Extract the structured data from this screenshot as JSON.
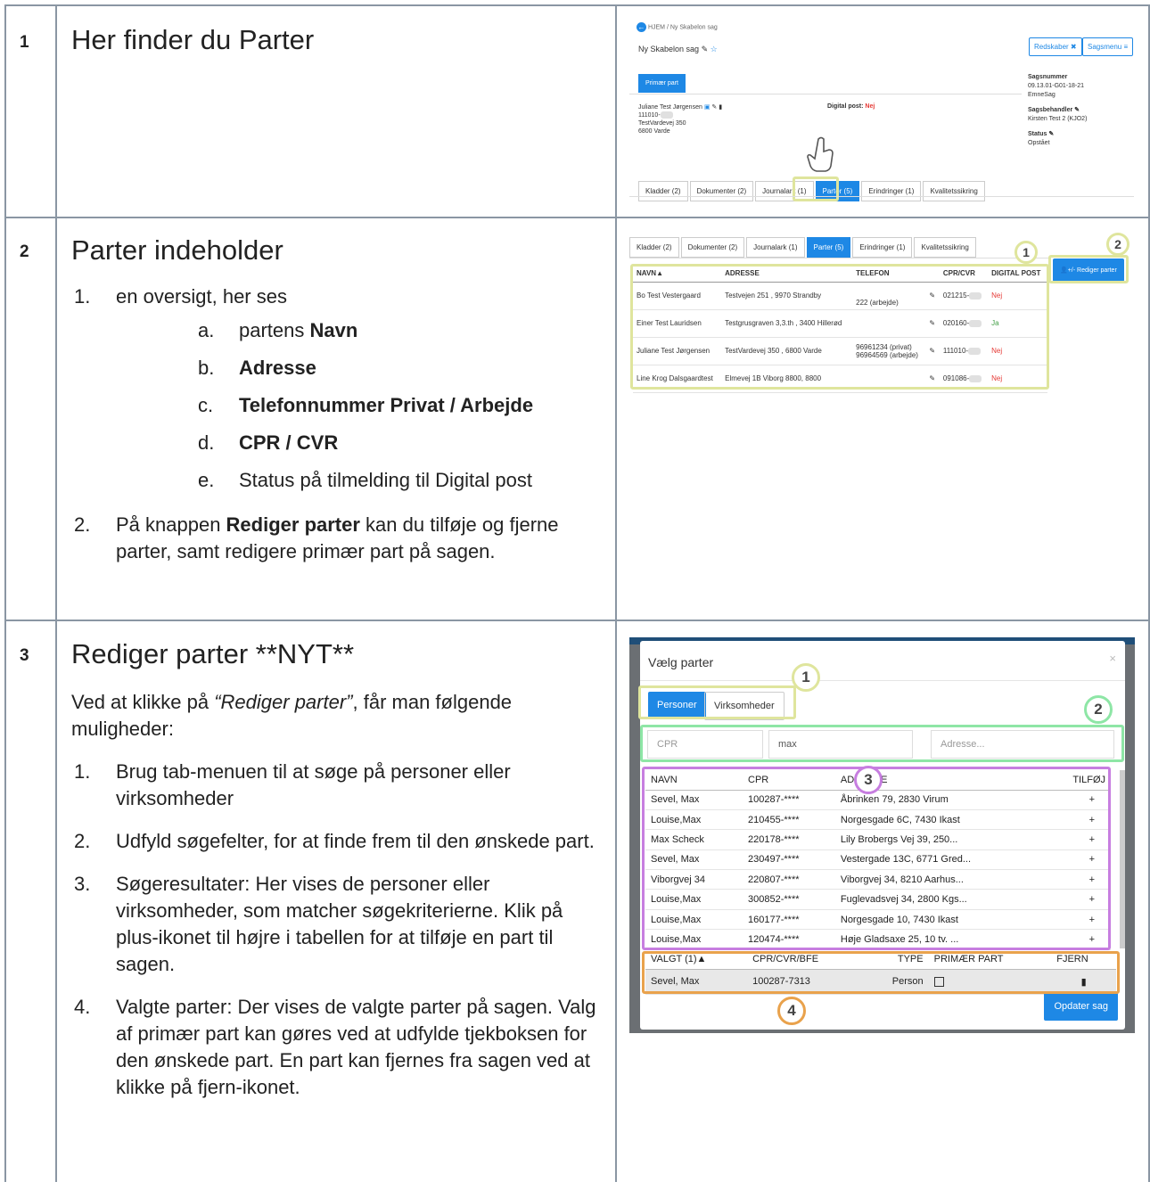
{
  "rows": [
    {
      "num": "1",
      "title": "Her finder du Parter"
    },
    {
      "num": "2",
      "title": "Parter indeholder",
      "items": [
        {
          "n": "1.",
          "text": "en oversigt, her ses",
          "sub": [
            {
              "n": "a.",
              "pre": "partens ",
              "bold": "Navn",
              "post": ""
            },
            {
              "n": "b.",
              "pre": "",
              "bold": "Adresse",
              "post": ""
            },
            {
              "n": "c.",
              "pre": "",
              "bold": "Telefonnummer Privat / Arbejde",
              "post": ""
            },
            {
              "n": "d.",
              "pre": "",
              "bold": "CPR / CVR",
              "post": ""
            },
            {
              "n": "e.",
              "pre": "Status på tilmelding til Digital post",
              "bold": "",
              "post": ""
            }
          ]
        },
        {
          "n": "2.",
          "pre": "På knappen ",
          "bold": "Rediger parter",
          "post": " kan du tilføje og fjerne parter, samt redigere primær part på sagen."
        }
      ]
    },
    {
      "num": "3",
      "title": "Rediger parter **NYT**",
      "intro_pre": "Ved at klikke på ",
      "intro_em": "“Rediger parter”",
      "intro_post": ", får man følgende muligheder:",
      "items": [
        {
          "n": "1.",
          "text": "Brug tab-menuen til at søge på personer eller virksomheder"
        },
        {
          "n": "2.",
          "text": "Udfyld søgefelter, for at finde frem til den ønskede part."
        },
        {
          "n": "3.",
          "text": "Søgeresultater: Her vises de personer eller virksomheder, som matcher søgekriterierne. Klik på plus-ikonet til højre i tabellen for at tilføje en part til sagen."
        },
        {
          "n": "4.",
          "text": "Valgte parter: Der vises de valgte parter på sagen. Valg af primær part kan gøres ved at udfylde tjekboksen for den ønskede part. En part kan fjernes fra sagen ved at klikke på fjern-ikonet."
        }
      ]
    }
  ],
  "shot1": {
    "breadcrumb": [
      "HJEM",
      "Ny Skabelon sag"
    ],
    "case_title": "Ny Skabelon sag",
    "btn_tools": "Redskaber",
    "btn_menu": "Sagsmenu",
    "primary_tab": "Primær part",
    "party_name": "Juliane Test Jørgensen",
    "party_cpr": "111010-",
    "party_addr1": "TestVardevej 350",
    "party_addr2": "6800 Varde",
    "digital_label": "Digital post:",
    "digital_val": "Nej",
    "meta": [
      {
        "label": "Sagsnummer",
        "value": "09.13.01-G01-18-21"
      },
      {
        "label": "",
        "value": "EmneSag"
      },
      {
        "label": "Sagsbehandler",
        "value": "Kirsten Test 2 (KJO2)"
      },
      {
        "label": "Status",
        "value": "Opstået"
      }
    ],
    "tabs": [
      "Kladder (2)",
      "Dokumenter (2)",
      "Journalark (1)",
      "Parter (5)",
      "Erindringer (1)",
      "Kvalitetssikring"
    ]
  },
  "shot2": {
    "tabs": [
      "Kladder (2)",
      "Dokumenter (2)",
      "Journalark (1)",
      "Parter (5)",
      "Erindringer (1)",
      "Kvalitetssikring"
    ],
    "edit_btn": "+/- Rediger parter",
    "badge1": "1",
    "badge2": "2",
    "headers": [
      "NAVN▲",
      "ADRESSE",
      "TELEFON",
      "",
      "CPR/CVR",
      "DIGITAL POST"
    ],
    "rows": [
      {
        "name": "Bo Test Vestergaard",
        "addr": "Testvejen 251 , 9970 Strandby",
        "phone": "222 (arbejde)",
        "cpr": "021215-",
        "dp": "Nej"
      },
      {
        "name": "Einer Test Lauridsen",
        "addr": "Testgrusgraven 3,3.th , 3400 Hillerød",
        "phone": "",
        "cpr": "020160-",
        "dp": "Ja"
      },
      {
        "name": "Juliane Test Jørgensen",
        "addr": "TestVardevej 350 , 6800 Varde",
        "phone": "96961234 (privat)\n96964569 (arbejde)",
        "cpr": "111010-",
        "dp": "Nej"
      },
      {
        "name": "Line Krog Dalsgaardtest",
        "addr": "Elmevej 1B Viborg 8800, 8800",
        "phone": "",
        "cpr": "091086-",
        "dp": "Nej"
      }
    ]
  },
  "shot3": {
    "title": "Vælg parter",
    "close": "×",
    "tabs": [
      "Personer",
      "Virksomheder"
    ],
    "inputs": {
      "cpr_ph": "CPR",
      "name_val": "max",
      "addr_ph": "Adresse..."
    },
    "headers": [
      "NAVN",
      "CPR",
      "ADRESSE",
      "TILFØJ"
    ],
    "results": [
      {
        "name": "Sevel, Max",
        "cpr": "100287-****",
        "addr": "Åbrinken 79, 2830 Virum"
      },
      {
        "name": "Louise,Max",
        "cpr": "210455-****",
        "addr": "Norgesgade 6C, 7430 Ikast"
      },
      {
        "name": "Max Scheck",
        "cpr": "220178-****",
        "addr": "Lily Brobergs Vej 39, 250..."
      },
      {
        "name": "Sevel, Max",
        "cpr": "230497-****",
        "addr": "Vestergade 13C, 6771 Gred..."
      },
      {
        "name": "Viborgvej 34",
        "cpr": "220807-****",
        "addr": "Viborgvej 34, 8210 Aarhus..."
      },
      {
        "name": "Louise,Max",
        "cpr": "300852-****",
        "addr": "Fuglevadsvej 34, 2800 Kgs..."
      },
      {
        "name": "Louise,Max",
        "cpr": "160177-****",
        "addr": "Norgesgade 10, 7430 Ikast"
      },
      {
        "name": "Louise,Max",
        "cpr": "120474-****",
        "addr": "Høje Gladsaxe 25, 10 tv. ..."
      }
    ],
    "sel_headers": [
      "VALGT (1)▲",
      "CPR/CVR/BFE",
      "TYPE",
      "PRIMÆR PART",
      "FJERN"
    ],
    "selected": [
      {
        "name": "Sevel, Max",
        "cpr": "100287-7313",
        "type": "Person"
      }
    ],
    "update_btn": "Opdater sag",
    "badges": [
      "1",
      "2",
      "3",
      "4"
    ],
    "ring_colors": [
      "#dfe59d",
      "#8ee6a6",
      "#c77ee0",
      "#e9a24c"
    ]
  }
}
